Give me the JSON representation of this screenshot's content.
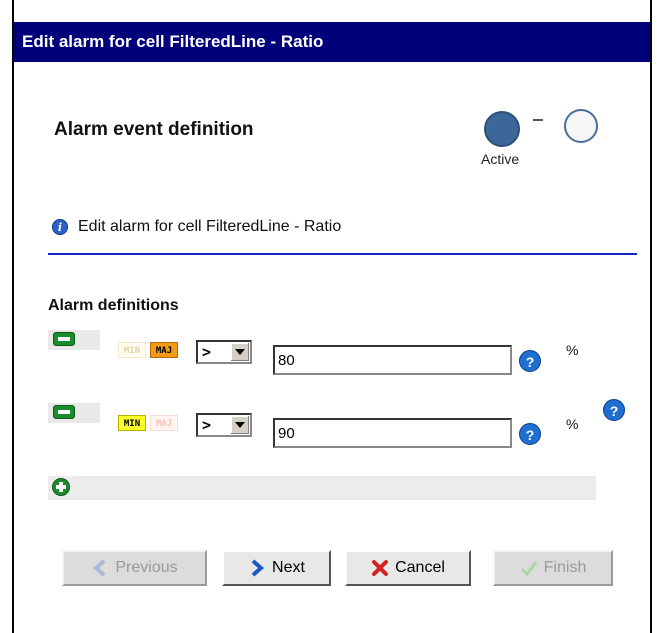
{
  "window": {
    "title": "Edit alarm for cell FilteredLine - Ratio"
  },
  "header": {
    "title": "Alarm event definition",
    "status_label": "Active",
    "colors": {
      "active": "#3c6799",
      "inactive": "#f6f6f6"
    }
  },
  "info": {
    "text": "Edit alarm for cell FilteredLine - Ratio",
    "icon": "info-icon"
  },
  "alarm_definitions": {
    "label": "Alarm definitions",
    "rows": [
      {
        "min_label": "MIN",
        "maj_label": "MAJ",
        "active_severity": "MAJ",
        "operator": ">",
        "value": "80",
        "unit": "%"
      },
      {
        "min_label": "MIN",
        "maj_label": "MAJ",
        "active_severity": "MIN",
        "operator": ">",
        "value": "90",
        "unit": "%"
      }
    ]
  },
  "buttons": {
    "previous": "Previous",
    "next": "Next",
    "cancel": "Cancel",
    "finish": "Finish"
  }
}
